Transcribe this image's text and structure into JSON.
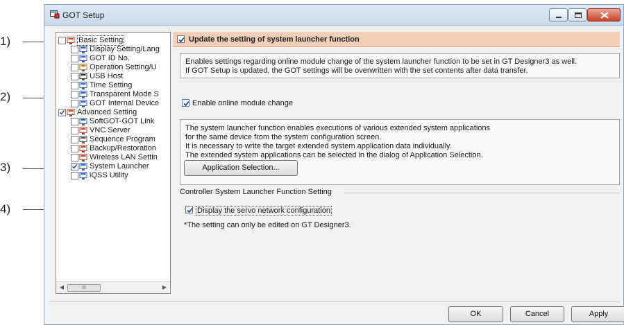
{
  "callouts": [
    "1)",
    "2)",
    "3)",
    "4)"
  ],
  "window": {
    "title": "GOT Setup"
  },
  "tree": {
    "items": [
      "Basic Setting",
      "Display Setting/Lang",
      "GOT ID No.",
      "Operation Setting/U",
      "USB Host",
      "Time Setting",
      "Transparent Mode S",
      "GOT Internal Device",
      "Advanced Setting",
      "SoftGOT-GOT Link",
      "VNC Server",
      "Sequence Program",
      "Backup/Restoration",
      "Wireless LAN Settin",
      "System Launcher",
      "iQSS Utility"
    ],
    "scroll_glyph": "III"
  },
  "panel": {
    "update_label": "Update the setting of system launcher function",
    "update_checked": true,
    "desc1": [
      "Enables settings regarding online module change of the system launcher function to be set in GT Designer3 as well.",
      "If GOT Setup is updated, the GOT settings will be overwritten with the set contents after data transfer."
    ],
    "online_label": "Enable online module change",
    "online_checked": true,
    "desc2": [
      "The system launcher function enables executions of various extended system applications",
      "for the same device from the system configuration screen.",
      "It is necessary to write the target extended system application data individually.",
      "The extended system applications can be selected in the dialog of Application Selection."
    ],
    "app_button": "Application Selection...",
    "group_title": "Controller System Launcher Function Setting",
    "servo_label": "Display the servo network configuration",
    "servo_checked": true,
    "note": "*The setting can only be edited on GT Designer3."
  },
  "footer": {
    "ok": "OK",
    "cancel": "Cancel",
    "apply": "Apply"
  }
}
